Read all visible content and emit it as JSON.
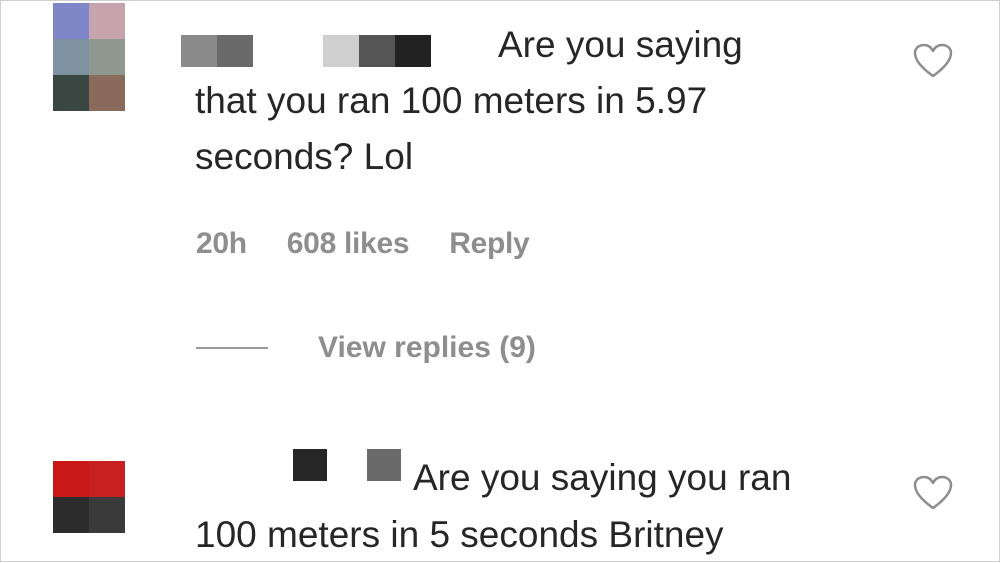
{
  "comments": [
    {
      "text_line1": "Are you saying",
      "text_rest": "that you ran 100 meters in 5.97\nseconds? Lol",
      "time": "20h",
      "likes": "608 likes",
      "reply_label": "Reply",
      "view_replies": "View replies (9)",
      "avatar_colors": [
        "#8087c8",
        "#c6a3ad",
        "#7e92a2",
        "#8f988e",
        "#3a4641",
        "#8a6a5a"
      ],
      "heart_icon": "heart-outline-icon"
    },
    {
      "text_line1": "Are you saying you ran",
      "text_rest": "100 meters in 5 seconds Britney",
      "avatar_colors": [
        "#c81818",
        "#c82020",
        "#2c2c2c",
        "#3a3a3a"
      ],
      "heart_icon": "heart-outline-icon"
    }
  ],
  "colors": {
    "text": "#262626",
    "meta": "#8e8e8e",
    "icon": "#8e8e8e"
  }
}
